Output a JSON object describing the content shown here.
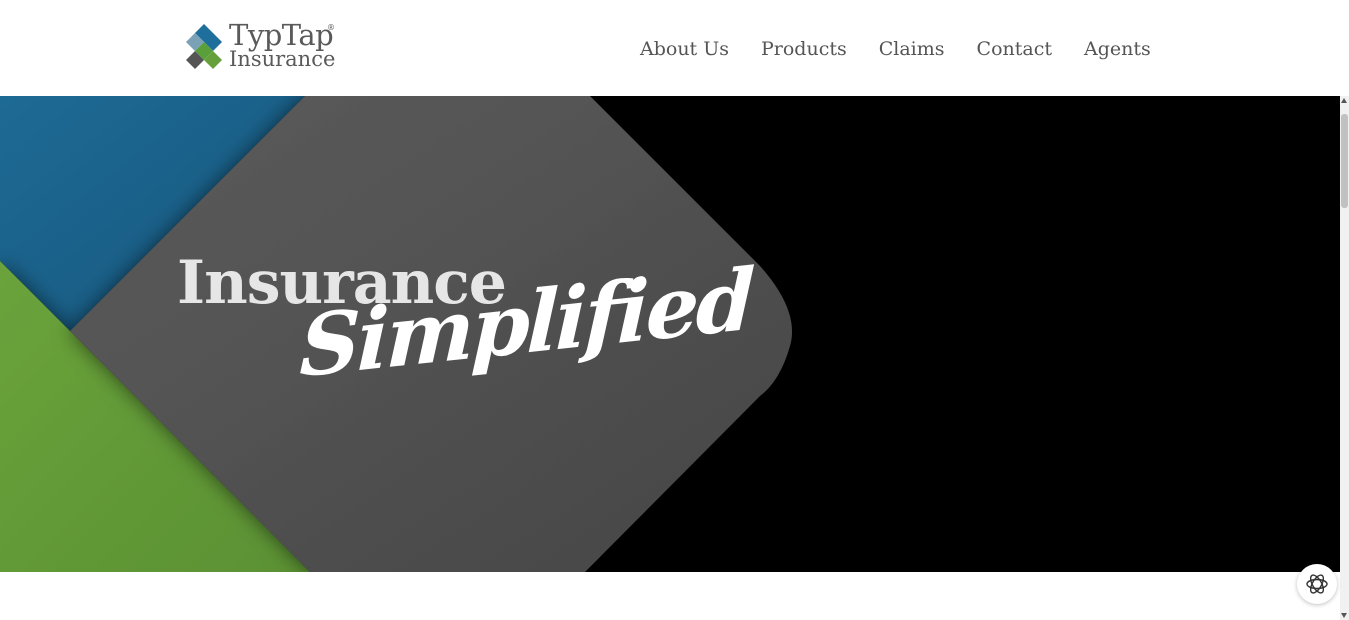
{
  "header": {
    "logo": {
      "brand": "TypTap",
      "registered": "®",
      "sub": "Insurance"
    },
    "nav": [
      {
        "label": "About Us"
      },
      {
        "label": "Products"
      },
      {
        "label": "Claims"
      },
      {
        "label": "Contact"
      },
      {
        "label": "Agents"
      }
    ]
  },
  "hero": {
    "title": "Insurance",
    "script": "Simplified"
  },
  "colors": {
    "blue": "#1f6f9c",
    "green": "#66a03a",
    "gray": "#555555",
    "black": "#000000"
  },
  "widgets": {
    "chat_icon": "openai-knot-icon"
  }
}
